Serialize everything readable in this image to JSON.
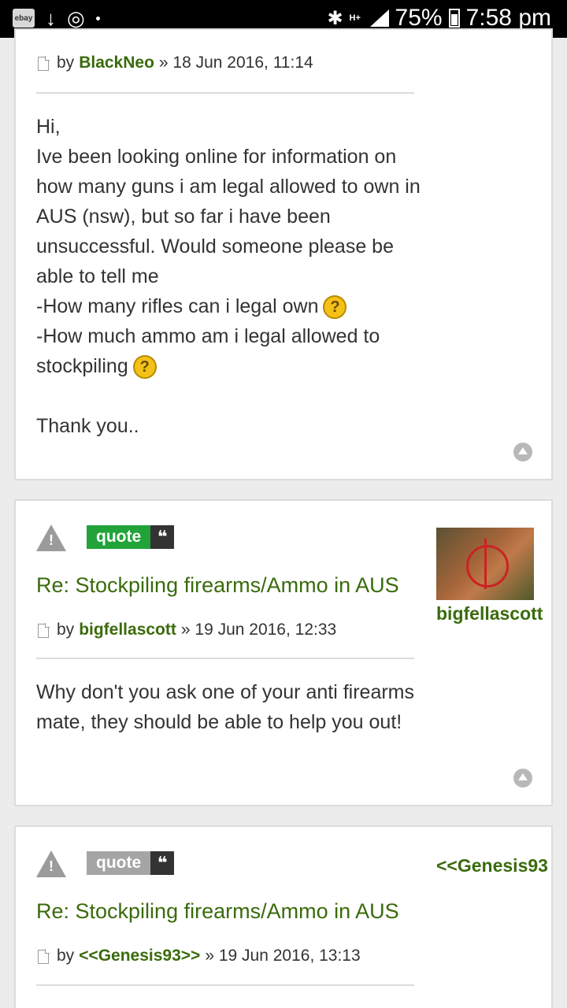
{
  "status_bar": {
    "ebay_label": "ebay",
    "download_glyph": "↓",
    "sync_glyph": "◎",
    "bluetooth_glyph": "✱",
    "network_type": "H+",
    "battery": "75%",
    "time": "7:58 pm"
  },
  "posts": [
    {
      "by_label": "by",
      "author": "BlackNeo",
      "date": "» 18 Jun 2016, 11:14",
      "body": [
        "Hi,",
        "Ive been looking online for information on how many guns i am legal allowed to own in AUS (nsw), but so far i have been unsuccessful. Would someone please be able to tell me",
        "-How many rifles can i legal own",
        "-How much ammo am i legal allowed to stockpiling",
        "",
        "Thank you.."
      ]
    },
    {
      "quote_label": "quote",
      "quote_glyph": "❝",
      "title": "Re: Stockpiling firearms/Ammo in AUS",
      "by_label": "by",
      "author": "bigfellascott",
      "date": "» 19 Jun 2016, 12:33",
      "sidebar_user": "bigfellascott",
      "body": "Why don't you ask one of your anti firearms mate, they should be able to help you out!"
    },
    {
      "quote_label": "quote",
      "quote_glyph": "❝",
      "title": "Re: Stockpiling firearms/Ammo in AUS",
      "by_label": "by",
      "author": "<<Genesis93>>",
      "date": "» 19 Jun 2016, 13:13",
      "sidebar_user": "<<Genesis93"
    }
  ],
  "icons": {
    "question": "?",
    "warning": "!"
  },
  "colors": {
    "link_green": "#3a6b0c",
    "quote_green": "#22a33a",
    "quote_grey": "#a5a5a5"
  }
}
